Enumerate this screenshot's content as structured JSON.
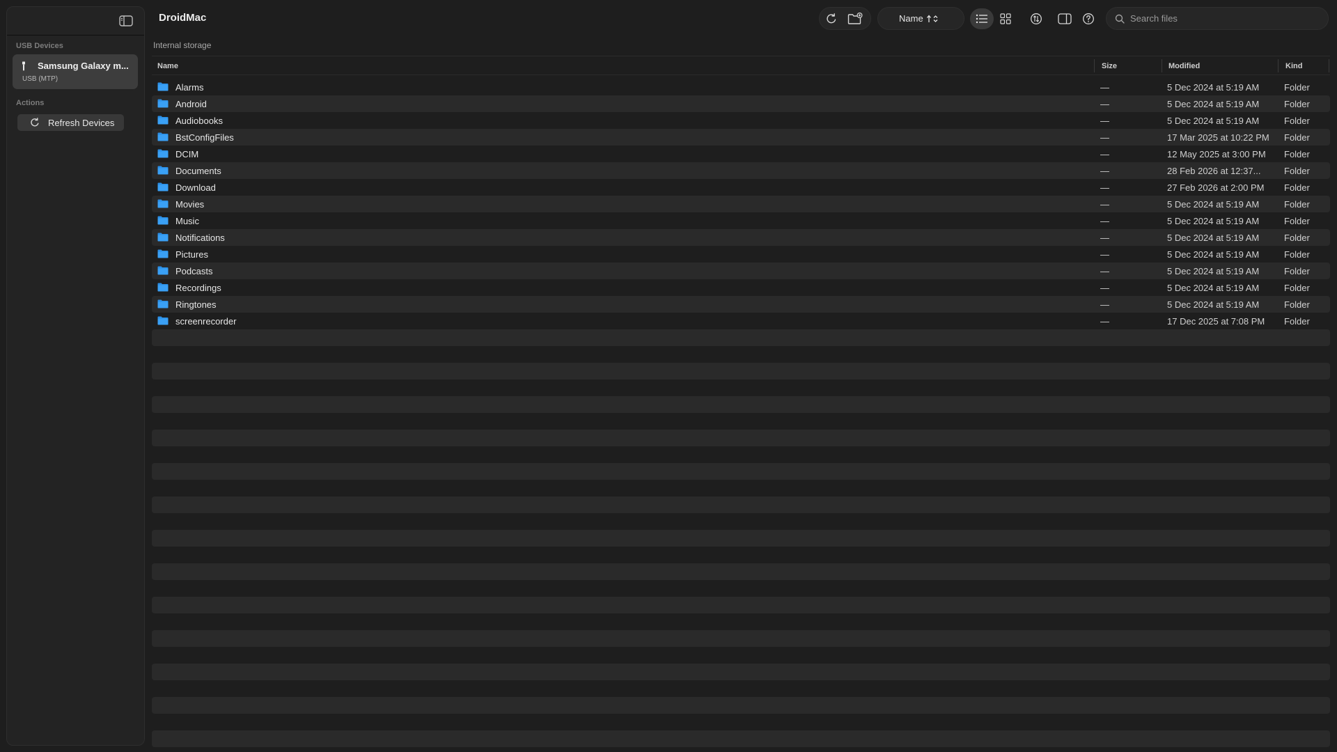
{
  "app": {
    "title": "DroidMac"
  },
  "sidebar": {
    "usb_label": "USB Devices",
    "device": {
      "name": "Samsung Galaxy m...",
      "sub": "USB (MTP)"
    },
    "actions_label": "Actions",
    "refresh_label": "Refresh Devices"
  },
  "toolbar": {
    "sort_label": "Name",
    "sort_arrows": "↑⌃⌄",
    "search_placeholder": "Search files"
  },
  "main": {
    "location": "Internal storage",
    "columns": {
      "name": "Name",
      "size": "Size",
      "modified": "Modified",
      "kind": "Kind"
    },
    "files": [
      {
        "name": "Alarms",
        "size": "—",
        "modified": "5 Dec 2024 at 5:19 AM",
        "kind": "Folder"
      },
      {
        "name": "Android",
        "size": "—",
        "modified": "5 Dec 2024 at 5:19 AM",
        "kind": "Folder"
      },
      {
        "name": "Audiobooks",
        "size": "—",
        "modified": "5 Dec 2024 at 5:19 AM",
        "kind": "Folder"
      },
      {
        "name": "BstConfigFiles",
        "size": "—",
        "modified": "17 Mar 2025 at 10:22 PM",
        "kind": "Folder"
      },
      {
        "name": "DCIM",
        "size": "—",
        "modified": "12 May 2025 at 3:00 PM",
        "kind": "Folder"
      },
      {
        "name": "Documents",
        "size": "—",
        "modified": "28 Feb 2026 at 12:37...",
        "kind": "Folder"
      },
      {
        "name": "Download",
        "size": "—",
        "modified": "27 Feb 2026 at 2:00 PM",
        "kind": "Folder"
      },
      {
        "name": "Movies",
        "size": "—",
        "modified": "5 Dec 2024 at 5:19 AM",
        "kind": "Folder"
      },
      {
        "name": "Music",
        "size": "—",
        "modified": "5 Dec 2024 at 5:19 AM",
        "kind": "Folder"
      },
      {
        "name": "Notifications",
        "size": "—",
        "modified": "5 Dec 2024 at 5:19 AM",
        "kind": "Folder"
      },
      {
        "name": "Pictures",
        "size": "—",
        "modified": "5 Dec 2024 at 5:19 AM",
        "kind": "Folder"
      },
      {
        "name": "Podcasts",
        "size": "—",
        "modified": "5 Dec 2024 at 5:19 AM",
        "kind": "Folder"
      },
      {
        "name": "Recordings",
        "size": "—",
        "modified": "5 Dec 2024 at 5:19 AM",
        "kind": "Folder"
      },
      {
        "name": "Ringtones",
        "size": "—",
        "modified": "5 Dec 2024 at 5:19 AM",
        "kind": "Folder"
      },
      {
        "name": "screenrecorder",
        "size": "—",
        "modified": "17 Dec 2025 at 7:08 PM",
        "kind": "Folder"
      }
    ]
  },
  "colors": {
    "accent_folder": "#2b8fe6",
    "background": "#1e1e1e",
    "row_alt": "#2a2a2a"
  }
}
